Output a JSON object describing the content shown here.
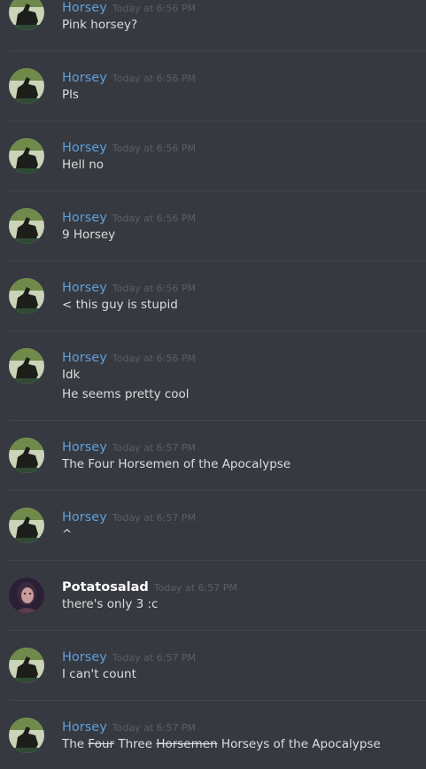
{
  "messages": [
    {
      "author": "Horsey",
      "timestamp": "Today at 6:56 PM",
      "lines": [
        "Pink horsey?"
      ]
    },
    {
      "author": "Horsey",
      "timestamp": "Today at 6:56 PM",
      "lines": [
        "Pls"
      ]
    },
    {
      "author": "Horsey",
      "timestamp": "Today at 6:56 PM",
      "lines": [
        "Hell no"
      ]
    },
    {
      "author": "Horsey",
      "timestamp": "Today at 6:56 PM",
      "lines": [
        "9 Horsey"
      ]
    },
    {
      "author": "Horsey",
      "timestamp": "Today at 6:56 PM",
      "lines": [
        "< this guy is stupid"
      ]
    },
    {
      "author": "Horsey",
      "timestamp": "Today at 6:56 PM",
      "lines": [
        "Idk",
        "He seems pretty cool"
      ]
    },
    {
      "author": "Horsey",
      "timestamp": "Today at 6:57 PM",
      "lines": [
        "The Four Horsemen of the Apocalypse"
      ]
    },
    {
      "author": "Horsey",
      "timestamp": "Today at 6:57 PM",
      "lines": [
        "^"
      ]
    },
    {
      "author": "Potatosalad",
      "timestamp": "Today at 6:57 PM",
      "lines": [
        "there's only 3 :c"
      ]
    },
    {
      "author": "Horsey",
      "timestamp": "Today at 6:57 PM",
      "lines": [
        "I can't count"
      ]
    },
    {
      "author": "Horsey",
      "timestamp": "Today at 6:57 PM",
      "last_message": {
        "part1": "The ",
        "struck1": "Four",
        "part2": " Three ",
        "struck2": "Horsemen",
        "part3": " Horseys of the Apocalypse"
      }
    }
  ],
  "colors": {
    "background": "#36393f",
    "horsey_name": "#5e9fdc",
    "potatosalad_name": "#ffffff",
    "timestamp": "#5c5f66",
    "text": "#dcddde"
  },
  "icons": {
    "horsey_avatar": "horse-rider-avatar-icon",
    "potatosalad_avatar": "user-photo-avatar-icon"
  }
}
